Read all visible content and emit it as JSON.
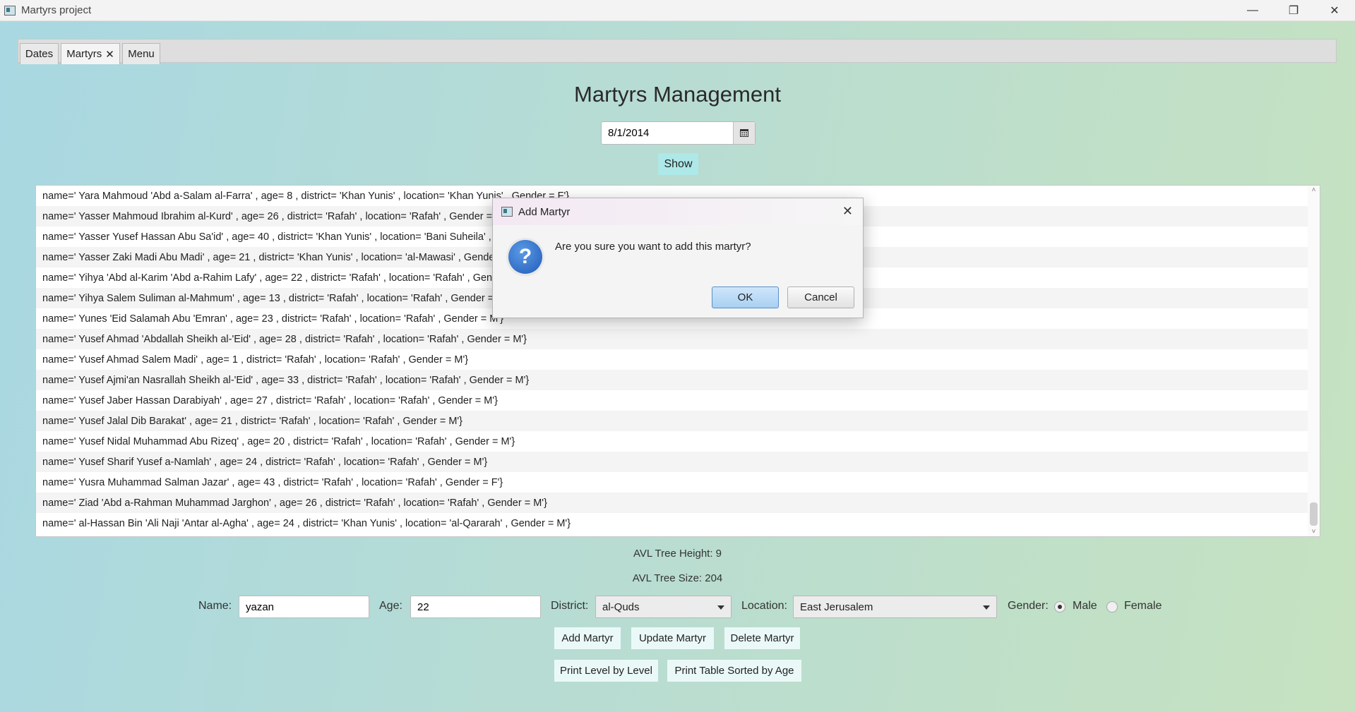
{
  "window": {
    "title": "Martyrs project",
    "controls": [
      "—",
      "❐",
      "✕"
    ]
  },
  "tabs": [
    {
      "label": "Dates",
      "closable": false
    },
    {
      "label": "Martyrs",
      "closable": true,
      "close_glyph": "✕"
    },
    {
      "label": "Menu",
      "closable": false
    }
  ],
  "page": {
    "heading": "Martyrs Management",
    "date_value": "8/1/2014",
    "show_label": "Show"
  },
  "list_rows": [
    "name=' Yara Mahmoud 'Abd a-Salam al-Farra' , age= 8 , district= 'Khan Yunis' , location= 'Khan Yunis' , Gender =  F'}",
    "name=' Yasser Mahmoud Ibrahim al-Kurd' , age= 26 , district= 'Rafah' , location= 'Rafah' , Gender =  M'}",
    "name=' Yasser Yusef Hassan Abu Sa'id' , age= 40 , district= 'Khan Yunis' , location= 'Bani Suheila' , Gender =  M'}",
    "name=' Yasser Zaki Madi Abu Madi' , age= 21 , district= 'Khan Yunis' , location= 'al-Mawasi' , Gender =  M'}",
    "name=' Yihya 'Abd al-Karim 'Abd a-Rahim Lafy' , age= 22 , district= 'Rafah' , location= 'Rafah' , Gender =  M'}",
    "name=' Yihya Salem Suliman al-Mahmum' , age= 13 , district= 'Rafah' , location= 'Rafah' , Gender =  M'}",
    "name=' Yunes 'Eid Salamah Abu 'Emran' , age= 23 , district= 'Rafah' , location= 'Rafah' , Gender =  M'}",
    "name=' Yusef Ahmad 'Abdallah Sheikh al-'Eid' , age= 28 , district= 'Rafah' , location= 'Rafah' , Gender =  M'}",
    "name=' Yusef Ahmad Salem Madi' , age= 1 , district= 'Rafah' , location= 'Rafah' , Gender =  M'}",
    "name=' Yusef Ajmi'an Nasrallah Sheikh al-'Eid' , age= 33 , district= 'Rafah' , location= 'Rafah' , Gender =  M'}",
    "name=' Yusef Jaber Hassan Darabiyah' , age= 27 , district= 'Rafah' , location= 'Rafah' , Gender =  M'}",
    "name=' Yusef Jalal Dib Barakat' , age= 21 , district= 'Rafah' , location= 'Rafah' , Gender =  M'}",
    "name=' Yusef Nidal Muhammad Abu Rizeq' , age= 20 , district= 'Rafah' , location= 'Rafah' , Gender =  M'}",
    "name=' Yusef Sharif Yusef a-Namlah' , age= 24 , district= 'Rafah' , location= 'Rafah' , Gender =  M'}",
    "name=' Yusra Muhammad Salman Jazar' , age= 43 , district= 'Rafah' , location= 'Rafah' , Gender =  F'}",
    "name=' Ziad 'Abd a-Rahman Muhammad Jarghon' , age= 26 , district= 'Rafah' , location= 'Rafah' , Gender =  M'}",
    "name=' al-Hassan Bin 'Ali Naji 'Antar al-Agha' , age= 24 , district= 'Khan Yunis' , location= 'al-Qararah' , Gender =  M'}"
  ],
  "stats": {
    "height_text": "AVL Tree Height: 9",
    "size_text": "AVL Tree Size: 204"
  },
  "form": {
    "name_label": "Name:",
    "name_value": "yazan",
    "age_label": "Age:",
    "age_value": "22",
    "district_label": "District:",
    "district_value": "al-Quds",
    "location_label": "Location:",
    "location_value": "East Jerusalem",
    "gender_label": "Gender:",
    "gender_options": [
      "Male",
      "Female"
    ],
    "gender_selected": "Male"
  },
  "buttons": {
    "add": "Add Martyr",
    "update": "Update Martyr",
    "delete": "Delete Martyr",
    "print_level": "Print Level by Level",
    "print_table": "Print Table Sorted by Age"
  },
  "dialog": {
    "title": "Add Martyr",
    "close_glyph": "✕",
    "icon_glyph": "?",
    "message": "Are you sure you want to add this martyr?",
    "ok_label": "OK",
    "cancel_label": "Cancel"
  },
  "colors": {
    "show_button_bg": "#aee8e8",
    "action_button_bg": "#eaf9f8",
    "dialog_default_button": "#a9d0f2",
    "question_icon": "#1f5bb8"
  }
}
